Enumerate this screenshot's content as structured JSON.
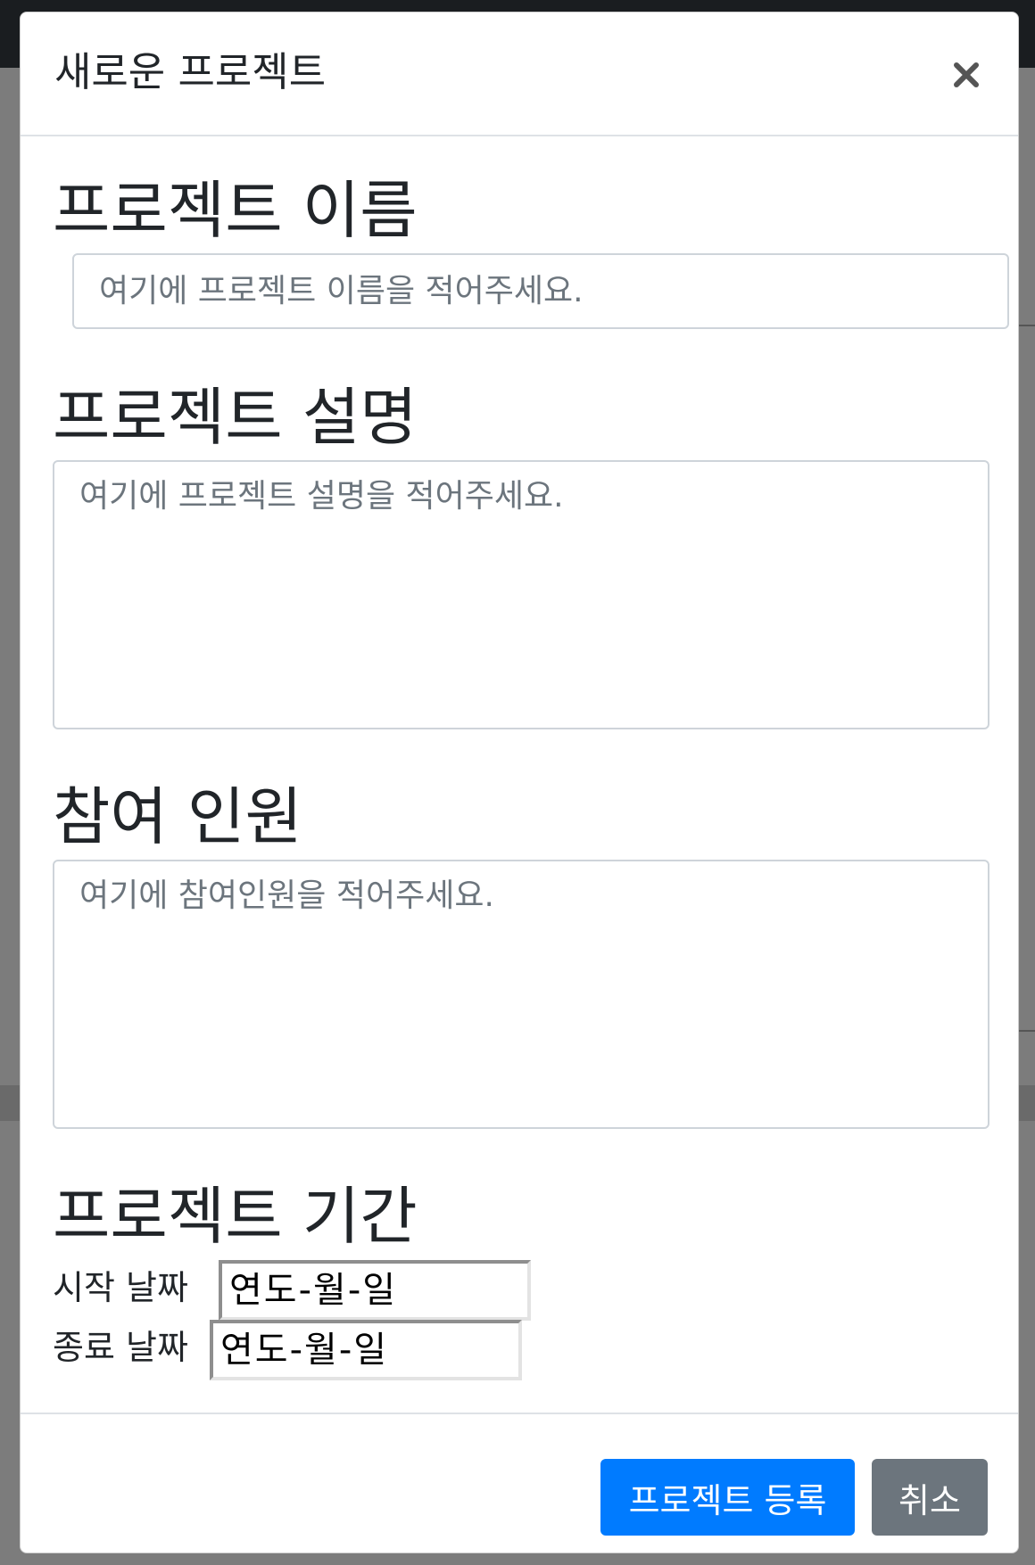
{
  "modal": {
    "title": "새로운 프로젝트",
    "close_label": "×"
  },
  "project_name": {
    "heading": "프로젝트 이름",
    "placeholder": "여기에 프로젝트 이름을 적어주세요.",
    "value": ""
  },
  "project_description": {
    "heading": "프로젝트 설명",
    "placeholder": "여기에 프로젝트 설명을 적어주세요.",
    "value": ""
  },
  "participants": {
    "heading": "참여 인원",
    "placeholder": "여기에 참여인원을 적어주세요.",
    "value": ""
  },
  "project_period": {
    "heading": "프로젝트 기간",
    "start_label": "시작 날짜",
    "start_value": "연도-월-일",
    "end_label": "종료 날짜",
    "end_value": "연도-월-일"
  },
  "footer": {
    "submit_label": "프로젝트 등록",
    "cancel_label": "취소"
  },
  "colors": {
    "primary": "#007bff",
    "secondary": "#6c757d",
    "backdrop": "#7c7c7c",
    "topbar": "#1a1d20"
  }
}
